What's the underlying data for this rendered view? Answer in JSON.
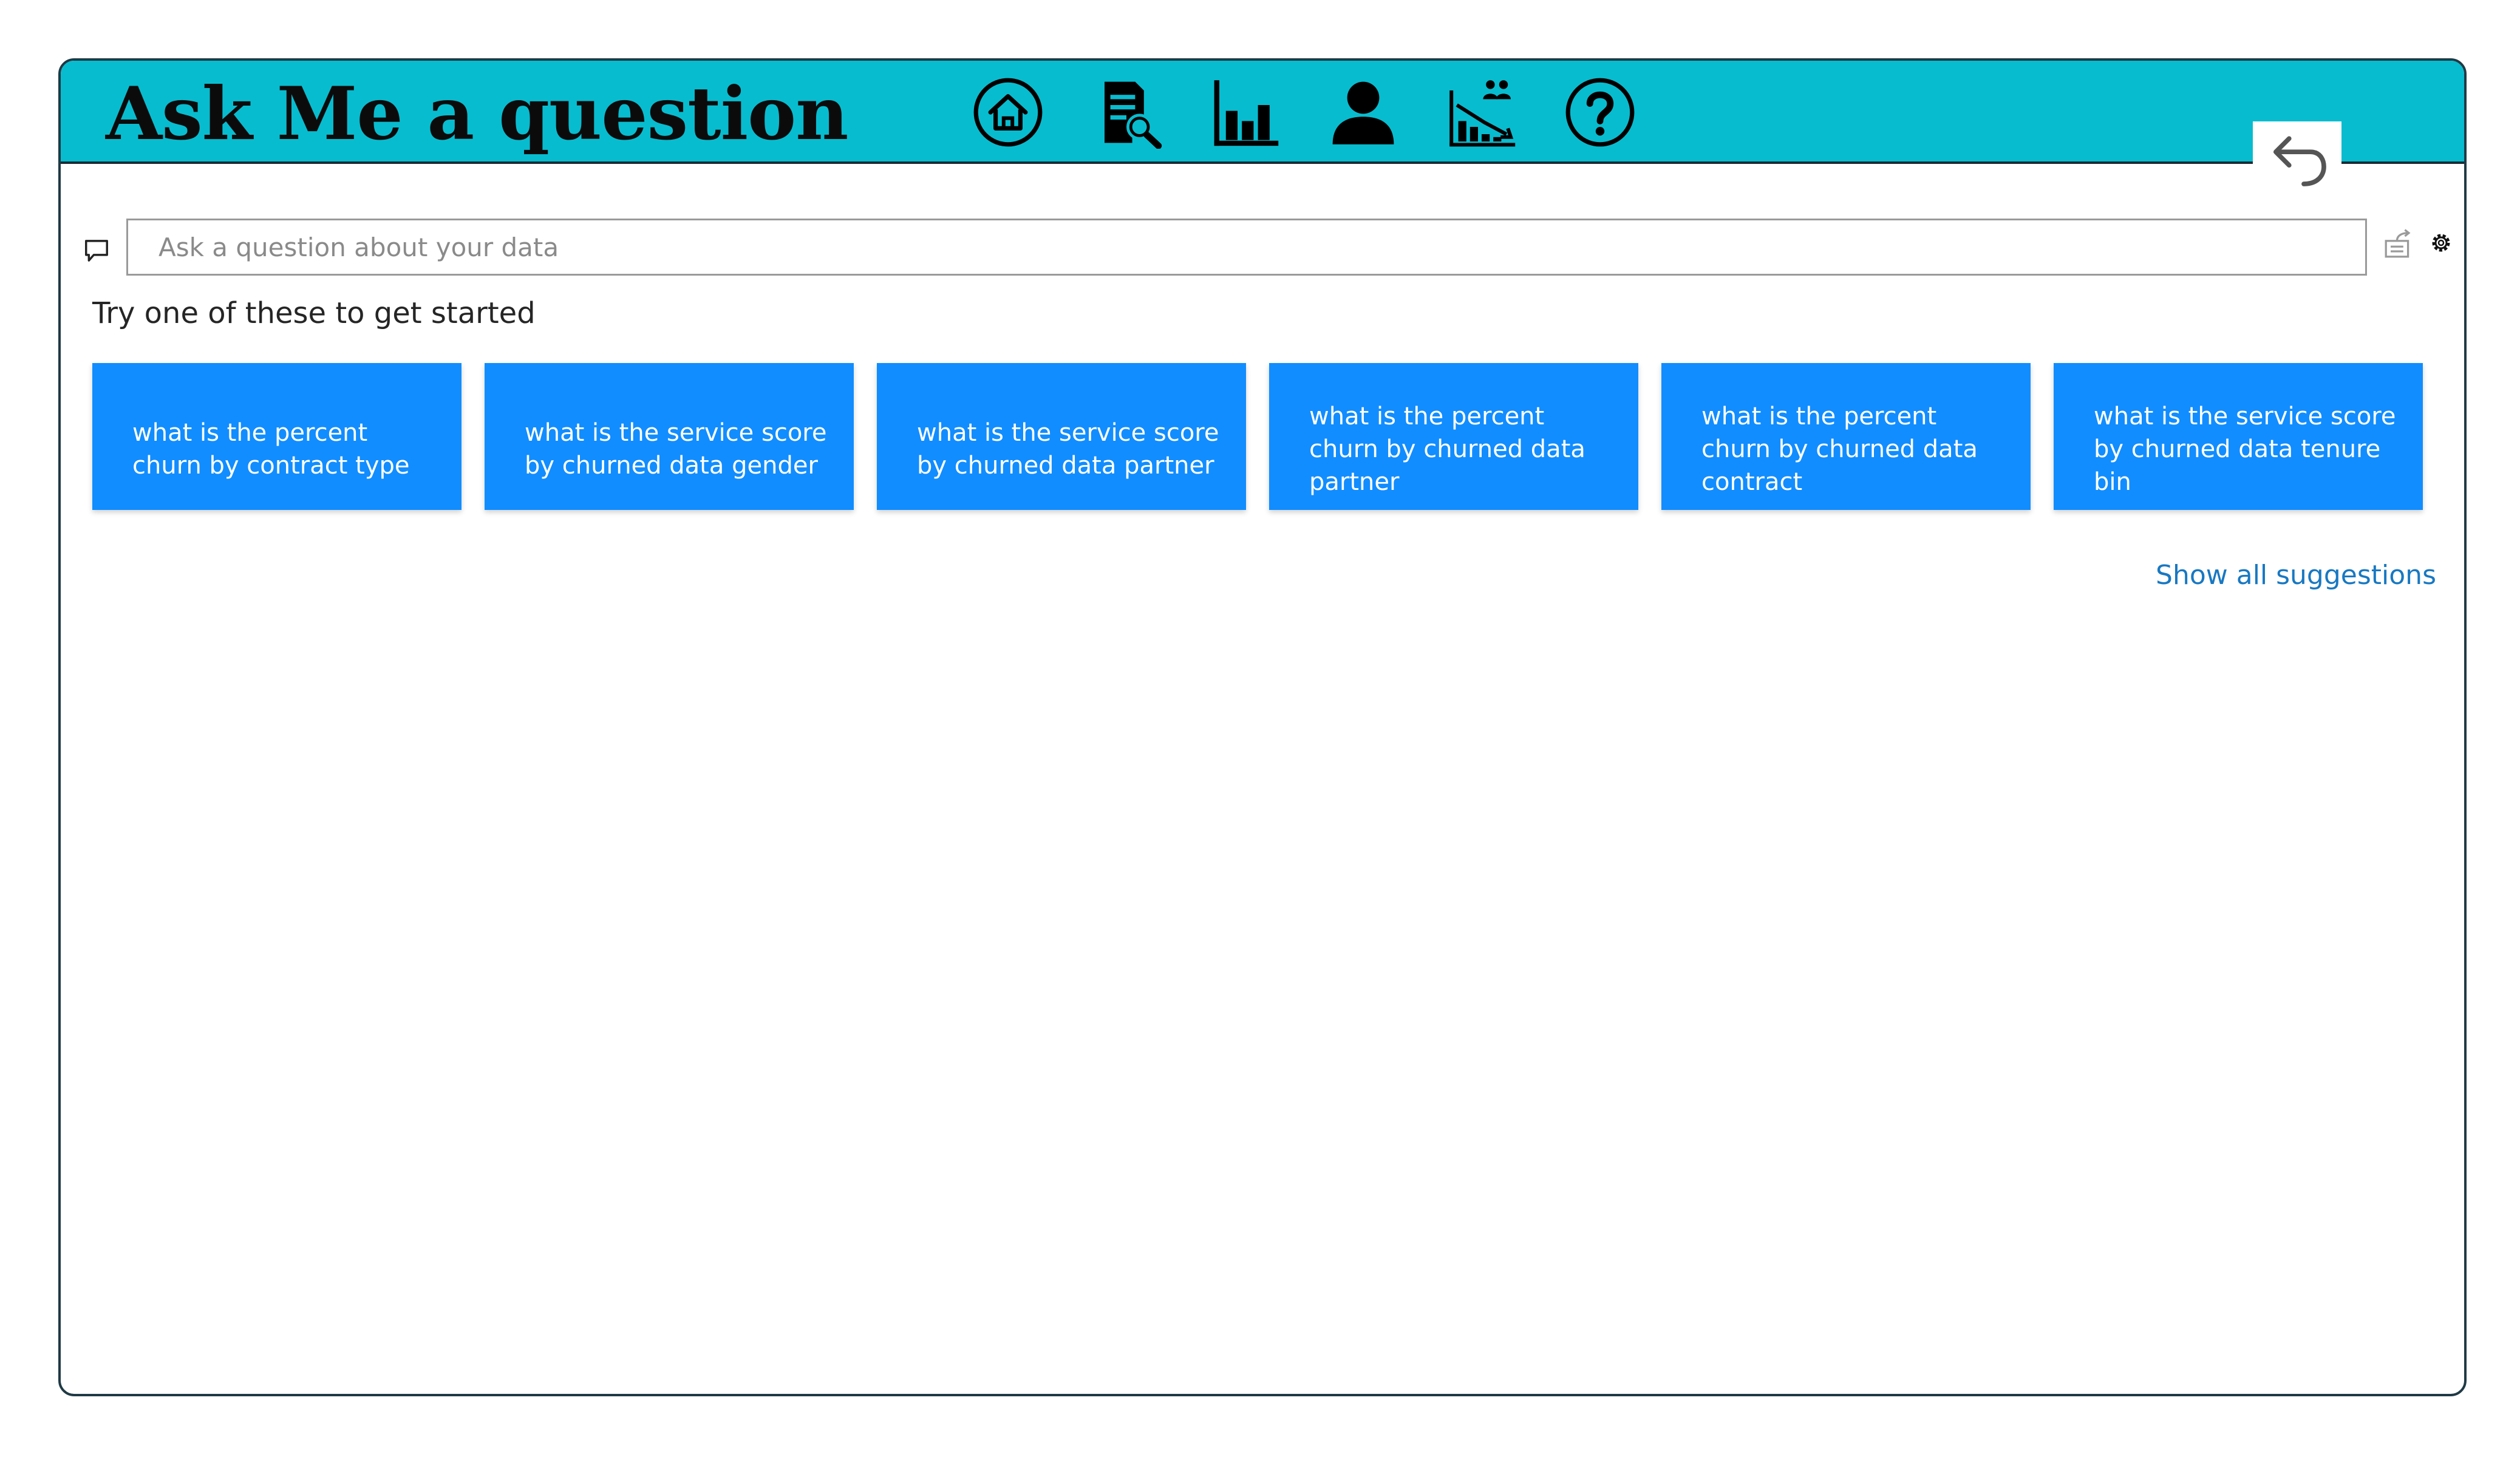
{
  "header": {
    "title": "Ask Me a question",
    "nav_icons": [
      "home-icon",
      "report-search-icon",
      "bar-chart-icon",
      "user-icon",
      "churn-trend-icon",
      "help-icon"
    ],
    "background_color": "#08bccf"
  },
  "back_button": {
    "icon": "undo-arrow-icon"
  },
  "qna": {
    "search_placeholder": "Ask a question about your data",
    "search_value": "",
    "prompt_heading": "Try one of these to get started",
    "suggestions": [
      "what is the percent churn by contract type",
      "what is the service score by churned data gender",
      "what is the service score by churned data partner",
      "what is the percent churn by churned data partner",
      "what is the percent churn by churned data contract",
      "what is the service score by churned data tenure bin"
    ],
    "suggestion_color": "#118dff",
    "show_all_label": "Show all suggestions",
    "link_color": "#1878c2"
  }
}
